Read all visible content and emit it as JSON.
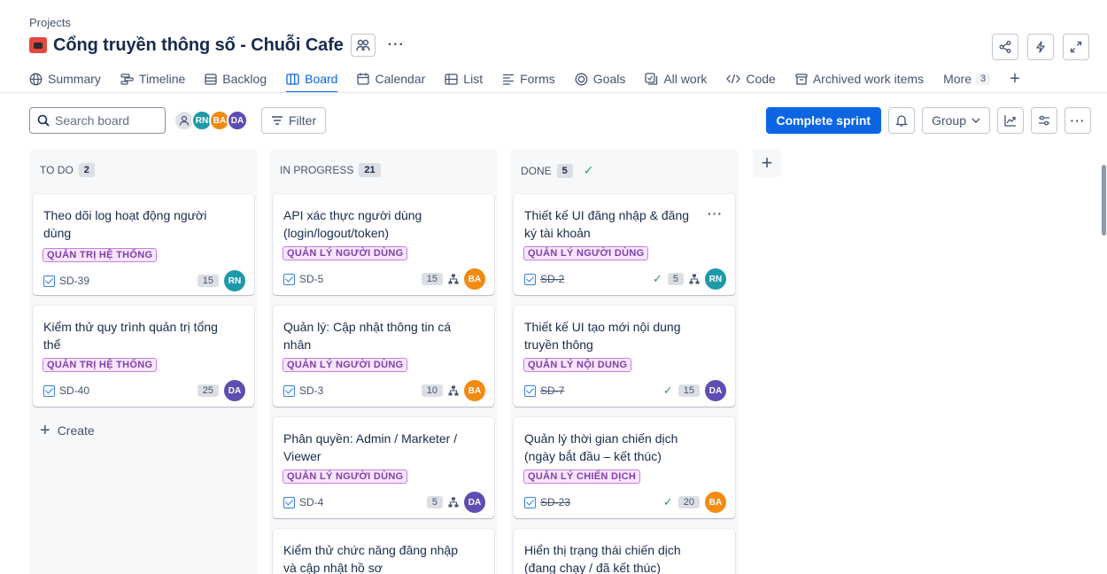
{
  "header": {
    "breadcrumb": "Projects",
    "title": "Cổng truyền thông số - Chuỗi Cafe",
    "more": "···"
  },
  "tabs": [
    {
      "label": "Summary",
      "icon": "globe-icon"
    },
    {
      "label": "Timeline",
      "icon": "timeline-icon"
    },
    {
      "label": "Backlog",
      "icon": "backlog-icon"
    },
    {
      "label": "Board",
      "icon": "board-icon",
      "active": true
    },
    {
      "label": "Calendar",
      "icon": "calendar-icon"
    },
    {
      "label": "List",
      "icon": "list-icon"
    },
    {
      "label": "Forms",
      "icon": "forms-icon"
    },
    {
      "label": "Goals",
      "icon": "goals-icon"
    },
    {
      "label": "All work",
      "icon": "all-work-icon"
    },
    {
      "label": "Code",
      "icon": "code-icon"
    },
    {
      "label": "Archived work items",
      "icon": "archive-icon"
    }
  ],
  "tabs_more": {
    "label": "More",
    "count": "3"
  },
  "toolbar": {
    "search_placeholder": "Search board",
    "filter_label": "Filter",
    "complete_sprint": "Complete sprint",
    "group_label": "Group"
  },
  "avatars": [
    {
      "initials": "RN",
      "color": "#1d9aaa"
    },
    {
      "initials": "BA",
      "color": "#f38a12"
    },
    {
      "initials": "DA",
      "color": "#5e4db2"
    }
  ],
  "columns": [
    {
      "name": "TO DO",
      "count": "2",
      "done": false,
      "cards": [
        {
          "summary": "Theo dõi log hoạt động người dùng",
          "label": "QUẢN TRỊ HỆ THỐNG",
          "key": "SD-39",
          "points": "15",
          "assignee": "RN",
          "assignee_color": "#1d9aaa"
        },
        {
          "summary": "Kiểm thử quy trình quản trị tổng thể",
          "label": "QUẢN TRỊ HỆ THỐNG",
          "key": "SD-40",
          "points": "25",
          "assignee": "DA",
          "assignee_color": "#5e4db2"
        }
      ],
      "create_label": "Create"
    },
    {
      "name": "IN PROGRESS",
      "count": "21",
      "done": false,
      "cards": [
        {
          "summary": "API xác thực người dùng (login/logout/token)",
          "label": "QUẢN LÝ NGƯỜI DÙNG",
          "key": "SD-5",
          "points": "15",
          "assignee": "BA",
          "assignee_color": "#f38a12",
          "child_icon": true
        },
        {
          "summary": "Quản lý: Cập nhật thông tin cá nhân",
          "label": "QUẢN LÝ NGƯỜI DÙNG",
          "key": "SD-3",
          "points": "10",
          "assignee": "BA",
          "assignee_color": "#f38a12",
          "child_icon": true
        },
        {
          "summary": "Phân quyền: Admin / Marketer / Viewer",
          "label": "QUẢN LÝ NGƯỜI DÙNG",
          "key": "SD-4",
          "points": "5",
          "assignee": "DA",
          "assignee_color": "#5e4db2",
          "child_icon": true
        },
        {
          "summary": "Kiểm thử chức năng đăng nhập và cập nhật hồ sơ",
          "partial": true
        }
      ]
    },
    {
      "name": "DONE",
      "count": "5",
      "done": true,
      "cards": [
        {
          "summary": "Thiết kế UI đăng nhập & đăng ký tài khoản",
          "label": "QUẢN LÝ NGƯỜI DÙNG",
          "key": "SD-2",
          "points": "5",
          "assignee": "RN",
          "assignee_color": "#1d9aaa",
          "child_icon": true,
          "resolved": true,
          "more": true
        },
        {
          "summary": "Thiết kế UI tạo mới nội dung truyền thông",
          "label": "QUẢN LÝ NỘI DUNG",
          "key": "SD-7",
          "points": "15",
          "assignee": "DA",
          "assignee_color": "#5e4db2",
          "resolved": true
        },
        {
          "summary": "Quản lý thời gian chiến dịch (ngày bắt đầu – kết thúc)",
          "label": "QUẢN LÝ CHIẾN DỊCH",
          "key": "SD-23",
          "points": "20",
          "assignee": "BA",
          "assignee_color": "#f38a12",
          "resolved": true
        },
        {
          "summary": "Hiển thị trạng thái chiến dịch (đang chạy / đã kết thúc)",
          "partial": true
        }
      ]
    }
  ]
}
